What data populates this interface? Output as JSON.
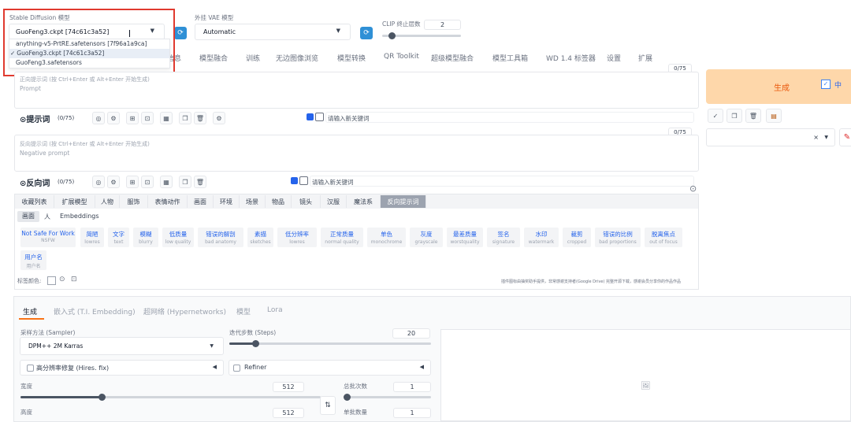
{
  "model": {
    "label": "Stable Diffusion 模型",
    "value": "GuoFeng3.ckpt [74c61c3a52]",
    "options": [
      "anything-v5-PrtRE.safetensors [7f96a1a9ca]",
      "GuoFeng3.ckpt [74c61c3a52]",
      "GuoFeng3.safetensors"
    ],
    "checkmark": "✓"
  },
  "vae": {
    "label": "外挂 VAE 模型",
    "value": "Automatic"
  },
  "clip": {
    "label": "CLIP 终止层数",
    "value": "2"
  },
  "tabs": [
    "信息",
    "模型融合",
    "训练",
    "无边图像浏览",
    "模型转换",
    "QR Toolkit",
    "超级模型融合",
    "模型工具箱",
    "WD 1.4 标签器",
    "设置",
    "扩展"
  ],
  "prompt": {
    "counter": "0/75",
    "hint": "正向提示词 (按 Ctrl+Enter 或 Alt+Enter 开始生成)",
    "placeholder": "Prompt",
    "toolbar_label": "提示词",
    "toolbar_count": "(0/75)",
    "keyword_placeholder": "请输入新关键词"
  },
  "negative": {
    "counter": "0/75",
    "hint": "反向提示词 (按 Ctrl+Enter 或 Alt+Enter 开始生成)",
    "placeholder": "Negative prompt",
    "toolbar_label": "反向词",
    "toolbar_count": "(0/75)",
    "keyword_placeholder": "请输入新关键词"
  },
  "categories": [
    "收藏列表",
    "扩展模型",
    "人物",
    "服饰",
    "表情动作",
    "画面",
    "环境",
    "场景",
    "物品",
    "镜头",
    "汉服",
    "魔法系",
    "反向提示词"
  ],
  "subtabs": [
    "画面",
    "人",
    "Embeddings"
  ],
  "tags": [
    {
      "en": "Not Safe For Work",
      "zh": "NSFW"
    },
    {
      "en": "简陋",
      "zh": "lowres"
    },
    {
      "en": "文字",
      "zh": "text"
    },
    {
      "en": "模糊",
      "zh": "blurry"
    },
    {
      "en": "低质量",
      "zh": "low quality"
    },
    {
      "en": "错误的解剖",
      "zh": "bad anatomy"
    },
    {
      "en": "素描",
      "zh": "sketches"
    },
    {
      "en": "低分辨率",
      "zh": "lowres"
    },
    {
      "en": "正常质量",
      "zh": "normal quality"
    },
    {
      "en": "单色",
      "zh": "monochrome"
    },
    {
      "en": "灰度",
      "zh": "grayscale"
    },
    {
      "en": "最差质量",
      "zh": "worstquality"
    },
    {
      "en": "签名",
      "zh": "signature"
    },
    {
      "en": "水印",
      "zh": "watermark"
    },
    {
      "en": "裁剪",
      "zh": "cropped"
    },
    {
      "en": "错误的比例",
      "zh": "bad proportions"
    },
    {
      "en": "脱离焦点",
      "zh": "out of focus"
    },
    {
      "en": "用户名",
      "zh": "用户名"
    }
  ],
  "tag_color_label": "标签颜色:",
  "footer_note": "插件图标由抽奖助手提供，非常感谢支持者(Google Drive) 完整开源下载，感谢会员分享你的作品作品",
  "gen_tabs": [
    "生成",
    "嵌入式 (T.I. Embedding)",
    "超网络 (Hypernetworks)",
    "模型",
    "Lora"
  ],
  "sampler": {
    "label": "采样方法 (Sampler)",
    "value": "DPM++ 2M Karras"
  },
  "steps": {
    "label": "迭代步数 (Steps)",
    "value": "20",
    "fraction": 0.13
  },
  "hires": {
    "label": "高分辨率修复 (Hires. fix)"
  },
  "refiner": {
    "label": "Refiner"
  },
  "width": {
    "label": "宽度",
    "value": "512",
    "fraction": 0.27
  },
  "height": {
    "label": "高度",
    "value": "512"
  },
  "batch_count": {
    "label": "总批次数",
    "value": "1"
  },
  "batch_size": {
    "label": "单批数量",
    "value": "1"
  },
  "generate": {
    "label": "生成",
    "lang": "中"
  },
  "accent": "#f97316"
}
